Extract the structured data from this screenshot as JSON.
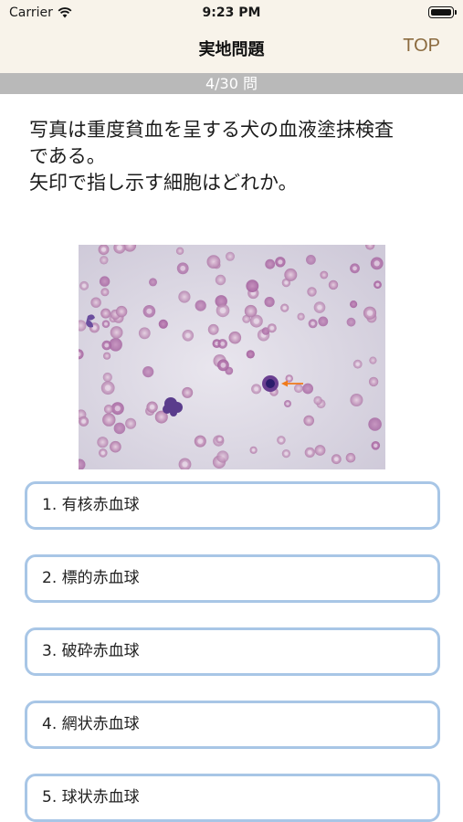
{
  "status_bar": {
    "carrier": "Carrier",
    "time": "9:23 PM"
  },
  "nav": {
    "title": "実地問題",
    "top_button": "TOP"
  },
  "progress": {
    "label": "4/30 問"
  },
  "question": {
    "lines": [
      "写真は重度貧血を呈する犬の血液塗抹検査",
      "である。",
      "矢印で指し示す細胞はどれか。"
    ]
  },
  "choices": [
    {
      "label": "1. 有核赤血球"
    },
    {
      "label": "2. 標的赤血球"
    },
    {
      "label": "3. 破砕赤血球"
    },
    {
      "label": "4. 網状赤血球"
    },
    {
      "label": "5. 球状赤血球"
    }
  ],
  "colors": {
    "nav_background": "#f8f3ea",
    "top_button": "#8b6a3e",
    "progress_strip": "#b9b9b9",
    "choice_border": "#a8c6e6",
    "arrow": "#f07a1a"
  }
}
